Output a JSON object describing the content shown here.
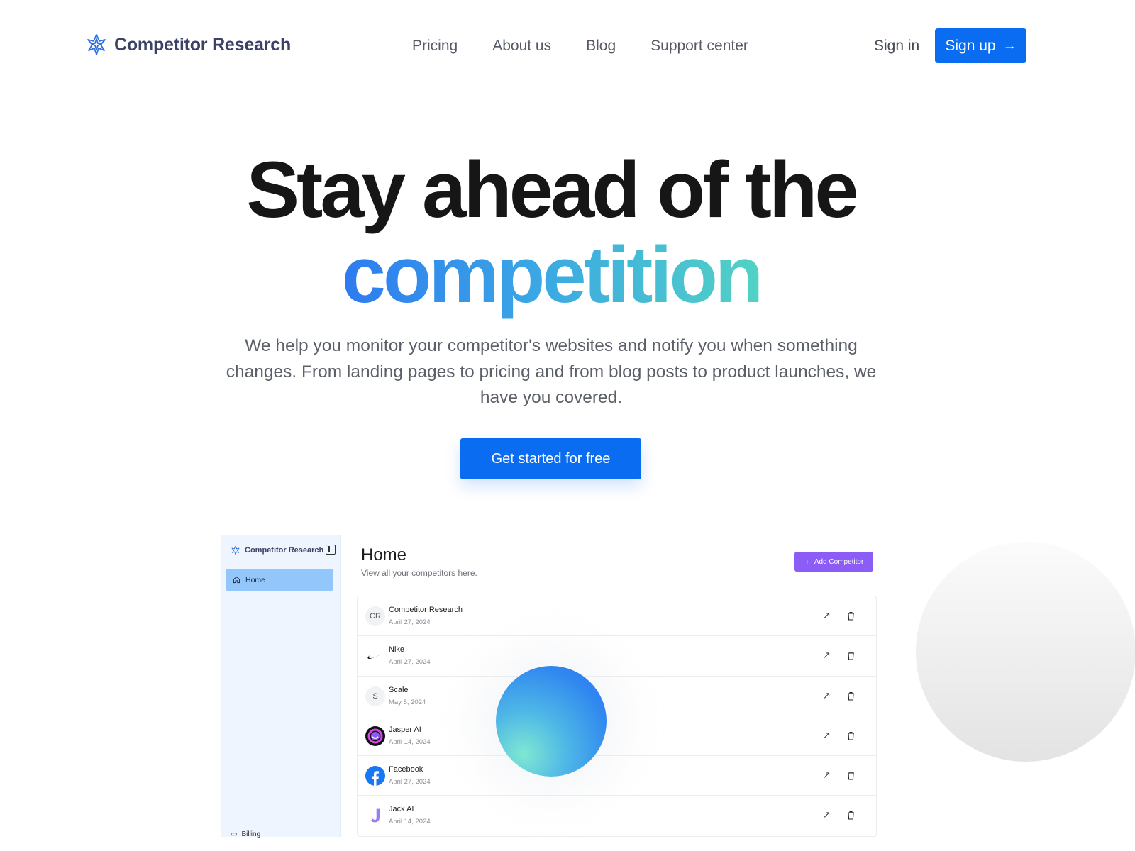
{
  "nav": {
    "brand": "Competitor Research",
    "links": [
      "Pricing",
      "About us",
      "Blog",
      "Support center"
    ],
    "sign_in": "Sign in",
    "sign_up": "Sign up"
  },
  "hero": {
    "title_line1": "Stay ahead of the",
    "title_line2": "competition",
    "subtitle": "We help you monitor your competitor's websites and notify you when something changes. From landing pages to pricing and from blog posts to product launches, we have you covered.",
    "cta": "Get started for free"
  },
  "app": {
    "brand": "Competitor Research",
    "nav_home": "Home",
    "nav_billing": "Billing",
    "title": "Home",
    "subtitle": "View all your competitors here.",
    "add_button": "Add Competitor",
    "competitors": [
      {
        "name": "Competitor Research",
        "date": "April 27, 2024",
        "avatar": "CR",
        "avatar_type": "initials"
      },
      {
        "name": "Nike",
        "date": "April 27, 2024",
        "avatar": "swoosh-icon",
        "avatar_type": "icon"
      },
      {
        "name": "Scale",
        "date": "May 5, 2024",
        "avatar": "S",
        "avatar_type": "initials"
      },
      {
        "name": "Jasper AI",
        "date": "April 14, 2024",
        "avatar": "jasper-logo-icon",
        "avatar_type": "icon"
      },
      {
        "name": "Facebook",
        "date": "April 27, 2024",
        "avatar": "facebook-icon",
        "avatar_type": "icon"
      },
      {
        "name": "Jack AI",
        "date": "April 14, 2024",
        "avatar": "jack-logo-icon",
        "avatar_type": "icon"
      }
    ]
  },
  "colors": {
    "primary": "#0a6cf0",
    "accent_purple": "#8b5cf6",
    "sidebar_bg": "#eef5fe",
    "sidebar_active": "#93c6fb",
    "gradient_start": "#2e7bf0",
    "gradient_end": "#52d2c4"
  }
}
